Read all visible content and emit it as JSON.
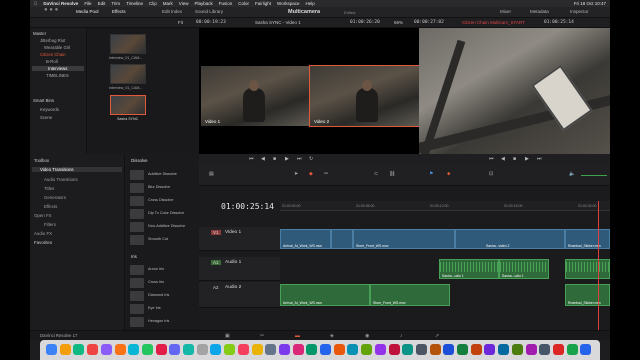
{
  "menubar": {
    "app": "DaVinci Resolve",
    "items": [
      "File",
      "Edit",
      "Trim",
      "Timeline",
      "Clip",
      "Mark",
      "View",
      "Playback",
      "Fusion",
      "Color",
      "Fairlight",
      "Workspace",
      "Help"
    ],
    "clock": "Fri 18 Oct 10:47"
  },
  "toolbar": {
    "media_pool": "Media Pool",
    "effects": "Effects",
    "edit_index": "Edit Index",
    "sound_library": "Sound Library",
    "center_title": "Multicamera",
    "center_status": "Edited",
    "mixer": "Mixer",
    "metadata": "Metadata",
    "inspector": "Inspector"
  },
  "viewer_header": {
    "zoom_left": "Fit",
    "timecode_source": "00:00:19:23",
    "clip_name": "Sasha SYNC - Video 1",
    "timecode_in": "01:00:26:20",
    "zoom_right": "66%",
    "timecode_out": "00:00:27:02",
    "timeline_name": "Citizen Chain Multicam_START",
    "timecode_program": "01:00:25:14"
  },
  "media_pool": {
    "bins": [
      {
        "label": "Master",
        "type": "hdr"
      },
      {
        "label": "Jitterbug Riot",
        "type": "item"
      },
      {
        "label": "Wearable Girl",
        "type": "item"
      },
      {
        "label": "Citizen Chain",
        "type": "hdr"
      },
      {
        "label": "B-Roll",
        "type": "item"
      },
      {
        "label": "Interviews",
        "type": "sel"
      },
      {
        "label": "TIMELINES",
        "type": "item"
      }
    ],
    "smart_bins_title": "Smart Bins",
    "smart_bins": [
      "Keywords",
      "Scene"
    ],
    "thumbnails": [
      {
        "label": "Interview_01_CAM..."
      },
      {
        "label": "Interview_01_CAM..."
      },
      {
        "label": "Sasha SYNC"
      }
    ]
  },
  "multicam": {
    "angles": [
      {
        "label": "Video 1"
      },
      {
        "label": "Video 2"
      }
    ]
  },
  "effects_tree": {
    "items": [
      {
        "label": "Toolbox",
        "sel": false
      },
      {
        "label": "Video Transitions",
        "sel": true
      },
      {
        "label": "Audio Transitions",
        "sel": false
      },
      {
        "label": "Titles",
        "sel": false
      },
      {
        "label": "Generators",
        "sel": false
      },
      {
        "label": "Effects",
        "sel": false
      },
      {
        "label": "Open FX",
        "sel": false
      },
      {
        "label": "Filters",
        "sel": false
      },
      {
        "label": "Audio FX",
        "sel": false
      },
      {
        "label": "Favorites",
        "sel": false
      }
    ]
  },
  "effects_list": {
    "section_dissolve": "Dissolve",
    "dissolves": [
      "Additive Dissolve",
      "Blur Dissolve",
      "Cross Dissolve",
      "Dip To Color Dissolve",
      "Non-Additive Dissolve",
      "Smooth Cut"
    ],
    "section_iris": "Iris",
    "irises": [
      "Arrow Iris",
      "Cross Iris",
      "Diamond Iris",
      "Eye Iris",
      "Hexagon Iris"
    ]
  },
  "timeline": {
    "timecode": "01:00:25:14",
    "ticks": [
      "01:00:00:00",
      "01:00:06:00",
      "01:00:12:00",
      "01:00:18:00",
      "01:00:24:00"
    ],
    "tracks": [
      {
        "id": "V1",
        "name": "Video 1"
      },
      {
        "id": "A1",
        "name": "Audio 1"
      },
      {
        "id": "A2",
        "name": "Audio 2"
      }
    ],
    "clips": {
      "v1_a": "Arrival_At_Work_WS.mov",
      "v1_b": "Store_Front_WS.mov",
      "v1_c": "Sasha...video 2",
      "v1_d": "Rosebud_Sticker.mov",
      "a1_a": "Sasha...udio 1",
      "a1_b": "Sasha...udio 1",
      "a2_a": "Arrival_At_Work_WS.mov",
      "a2_b": "Store_Front_WS.mov",
      "a2_c": "Rosebud_Sticker.mov"
    }
  },
  "brand": "DaVinci Resolve 17",
  "pages": [
    "media",
    "cut",
    "edit",
    "fusion",
    "color",
    "fairlight",
    "deliver"
  ],
  "colors": {
    "accent": "#e05a3a",
    "video_clip": "#2f5a7a",
    "audio_clip": "#2f6b3a",
    "playhead": "#e04040"
  }
}
